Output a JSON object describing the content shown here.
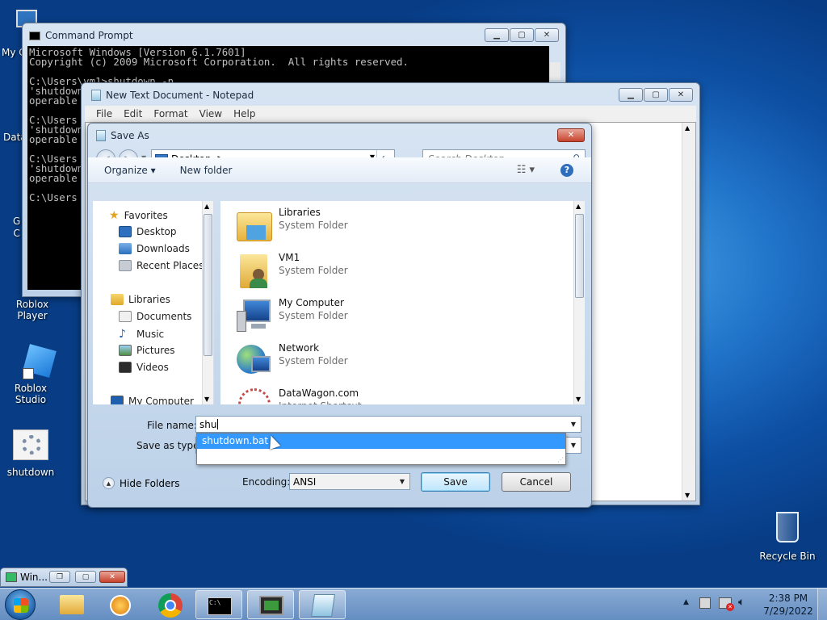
{
  "desktop": {
    "icons": [
      {
        "label": "My C"
      },
      {
        "label": "Data"
      },
      {
        "label": "G\nC"
      },
      {
        "label": "Roblox Player"
      },
      {
        "label": "Roblox Studio"
      },
      {
        "label": "shutdown"
      },
      {
        "label": "Recycle Bin"
      }
    ]
  },
  "cmd": {
    "title": "Command Prompt",
    "lines": "Microsoft Windows [Version 6.1.7601]\nCopyright (c) 2009 Microsoft Corporation.  All rights reserved.\n\nC:\\Users\\vm1>shutdown -n\n'shutdown\noperable\n\nC:\\Users\n'shutdown\noperable\n\nC:\\Users\n'shutdown\noperable\n\nC:\\Users"
  },
  "notepad": {
    "title": "New Text Document - Notepad",
    "menu": [
      "File",
      "Edit",
      "Format",
      "View",
      "Help"
    ]
  },
  "saveas": {
    "title": "Save As",
    "location": "Desktop",
    "search_placeholder": "Search Desktop",
    "toolbar": {
      "organize": "Organize",
      "new_folder": "New folder"
    },
    "nav": {
      "favorites": "Favorites",
      "desktop": "Desktop",
      "downloads": "Downloads",
      "recent": "Recent Places",
      "libraries": "Libraries",
      "documents": "Documents",
      "music": "Music",
      "pictures": "Pictures",
      "videos": "Videos",
      "computer": "My Computer"
    },
    "files": [
      {
        "name": "Libraries",
        "type": "System Folder"
      },
      {
        "name": "VM1",
        "type": "System Folder"
      },
      {
        "name": "My Computer",
        "type": "System Folder"
      },
      {
        "name": "Network",
        "type": "System Folder"
      },
      {
        "name": "DataWagon.com",
        "type": "Internet Shortcut"
      }
    ],
    "file_name_label": "File name:",
    "file_name_value": "shu",
    "save_type_label": "Save as type:",
    "autocomplete": "shutdown.bat",
    "hide_folders": "Hide Folders",
    "encoding_label": "Encoding:",
    "encoding_value": "ANSI",
    "save": "Save",
    "cancel": "Cancel"
  },
  "minimized": {
    "title": "Win..."
  },
  "clock": {
    "time": "2:38 PM",
    "date": "7/29/2022"
  }
}
